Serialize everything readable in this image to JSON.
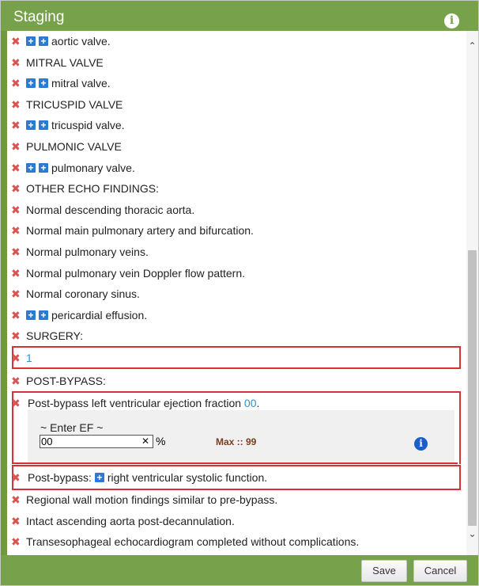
{
  "dialog": {
    "title": "Staging",
    "save_label": "Save",
    "cancel_label": "Cancel"
  },
  "rows": [
    {
      "text": "aortic valve.",
      "plus": 2
    },
    {
      "text": "MITRAL VALVE",
      "plus": 0
    },
    {
      "text": "mitral valve.",
      "plus": 2
    },
    {
      "text": "TRICUSPID VALVE",
      "plus": 0
    },
    {
      "text": "tricuspid valve.",
      "plus": 2
    },
    {
      "text": "PULMONIC VALVE",
      "plus": 0
    },
    {
      "text": "pulmonary valve.",
      "plus": 2
    },
    {
      "text": "OTHER ECHO FINDINGS:",
      "plus": 0
    },
    {
      "text": "Normal descending thoracic aorta.",
      "plus": 0
    },
    {
      "text": "Normal main pulmonary artery and bifurcation.",
      "plus": 0
    },
    {
      "text": "Normal pulmonary veins.",
      "plus": 0
    },
    {
      "text": "Normal pulmonary vein Doppler flow pattern.",
      "plus": 0
    },
    {
      "text": "Normal coronary sinus.",
      "plus": 0
    },
    {
      "text": "pericardial effusion.",
      "plus": 2
    },
    {
      "text": "SURGERY:",
      "plus": 0
    }
  ],
  "surgery_value": "1",
  "post_bypass_heading": "POST-BYPASS:",
  "ef_row": {
    "text": "Post-bypass left ventricular ejection fraction",
    "value": "00",
    "suffix": "."
  },
  "ef_editor": {
    "label": "~ Enter EF ~",
    "input_value": "00",
    "clear_symbol": "✕",
    "unit": "%",
    "max_text": "Max :: 99"
  },
  "rv_row": {
    "prefix": "Post-bypass:",
    "text": "right ventricular systolic function."
  },
  "bottom_rows": [
    "Regional wall motion findings similar to pre-bypass.",
    "Intact ascending aorta post-decannulation.",
    "Transesophageal echocardiogram completed without complications."
  ],
  "icons": {
    "remove": "close-icon",
    "add": "plus-icon",
    "info": "info-icon"
  },
  "colors": {
    "header_green": "#77a14a",
    "remove_red": "#d9534f",
    "highlight_red": "#d93035",
    "link_blue": "#2f8fd0",
    "plus_blue": "#2b7bd6"
  }
}
